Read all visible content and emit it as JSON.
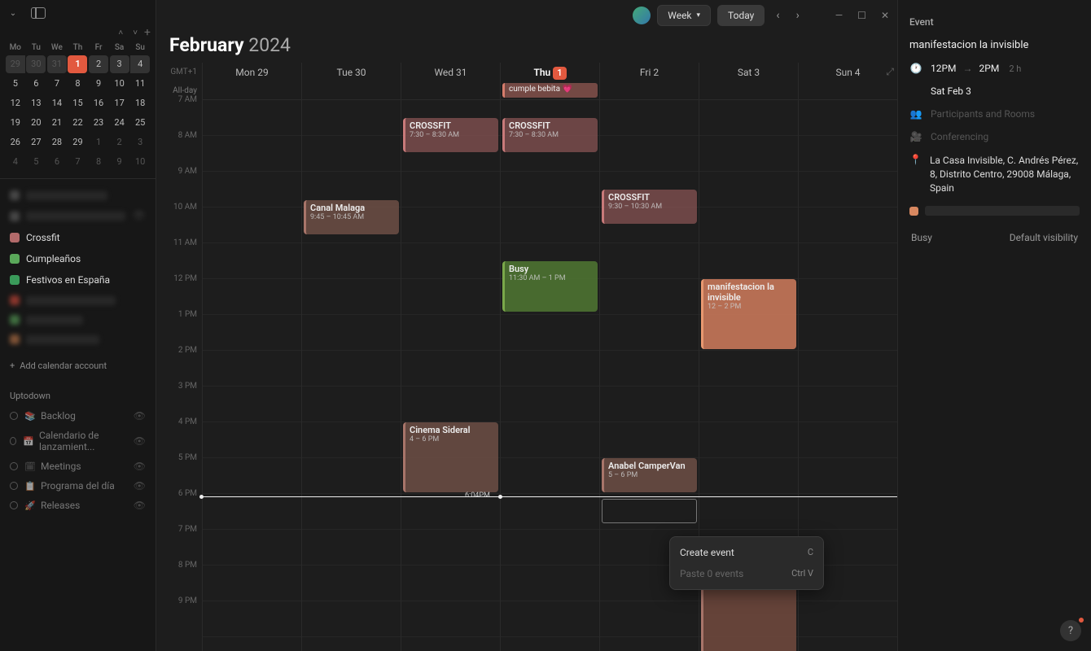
{
  "header": {
    "month": "February",
    "year": "2024",
    "view_label": "Week",
    "today_label": "Today",
    "timezone": "GMT+1",
    "now_label": "6:04PM"
  },
  "mini_cal": {
    "dow": [
      "Mo",
      "Tu",
      "We",
      "Th",
      "Fr",
      "Sa",
      "Su"
    ],
    "rows": [
      [
        "29",
        "30",
        "31",
        "1",
        "2",
        "3",
        "4"
      ],
      [
        "5",
        "6",
        "7",
        "8",
        "9",
        "10",
        "11"
      ],
      [
        "12",
        "13",
        "14",
        "15",
        "16",
        "17",
        "18"
      ],
      [
        "19",
        "20",
        "21",
        "22",
        "23",
        "24",
        "25"
      ],
      [
        "26",
        "27",
        "28",
        "29",
        "1",
        "2",
        "3"
      ],
      [
        "4",
        "5",
        "6",
        "7",
        "8",
        "9",
        "10"
      ]
    ]
  },
  "calendars": [
    {
      "name": "Crossfit",
      "color": "#b26a6a"
    },
    {
      "name": "Cumpleaños",
      "color": "#5aa85a"
    },
    {
      "name": "Festivos en España",
      "color": "#3a9a5a"
    }
  ],
  "hidden_calendars_colors": [
    "#d84a3a",
    "#5aa85a",
    "#c47a4a"
  ],
  "add_account": "Add calendar account",
  "project_section": "Uptodown",
  "projects": [
    {
      "name": "Backlog",
      "icon": "📚"
    },
    {
      "name": "Calendario de lanzamient...",
      "icon": "📅"
    },
    {
      "name": "Meetings",
      "icon": "🗓"
    },
    {
      "name": "Programa del día",
      "icon": "📋"
    },
    {
      "name": "Releases",
      "icon": "🚀"
    }
  ],
  "allday_label": "All-day",
  "days": [
    {
      "label": "Mon 29"
    },
    {
      "label": "Tue 30"
    },
    {
      "label": "Wed 31"
    },
    {
      "label": "Thu",
      "badge": "1"
    },
    {
      "label": "Fri 2"
    },
    {
      "label": "Sat 3"
    },
    {
      "label": "Sun 4"
    }
  ],
  "hours": [
    "7 AM",
    "8 AM",
    "9 AM",
    "10 AM",
    "11 AM",
    "12 PM",
    "1 PM",
    "2 PM",
    "3 PM",
    "4 PM",
    "5 PM",
    "6 PM",
    "7 PM",
    "8 PM",
    "9 PM"
  ],
  "events": {
    "allday_thu": "cumple bebita 💗",
    "canal": {
      "title": "Canal Malaga",
      "sub": "9:45 – 10:45 AM"
    },
    "cf_wed": {
      "title": "CROSSFIT",
      "sub": "7:30 – 8:30 AM"
    },
    "cf_thu": {
      "title": "CROSSFIT",
      "sub": "7:30 – 8:30 AM"
    },
    "cf_fri": {
      "title": "CROSSFIT",
      "sub": "9:30 – 10:30 AM"
    },
    "busy": {
      "title": "Busy",
      "sub": "11:30 AM – 1 PM"
    },
    "cinema": {
      "title": "Cinema Sideral",
      "sub": "4 – 6 PM"
    },
    "anabel": {
      "title": "Anabel CamperVan",
      "sub": "5 – 6 PM"
    },
    "mani": {
      "title": "manifestacion la invisible",
      "sub": "12 – 2 PM"
    }
  },
  "context_menu": {
    "create": "Create event",
    "create_sc": "C",
    "paste": "Paste 0 events",
    "paste_sc": "Ctrl V"
  },
  "detail": {
    "heading": "Event",
    "title": "manifestacion la invisible",
    "start": "12PM",
    "end": "2PM",
    "duration": "2 h",
    "date": "Sat Feb 3",
    "participants": "Participants and Rooms",
    "conferencing": "Conferencing",
    "location": "La Casa Invisible, C. Andrés Pérez, 8, Distrito Centro, 29008 Málaga, Spain",
    "busy": "Busy",
    "visibility": "Default visibility"
  }
}
